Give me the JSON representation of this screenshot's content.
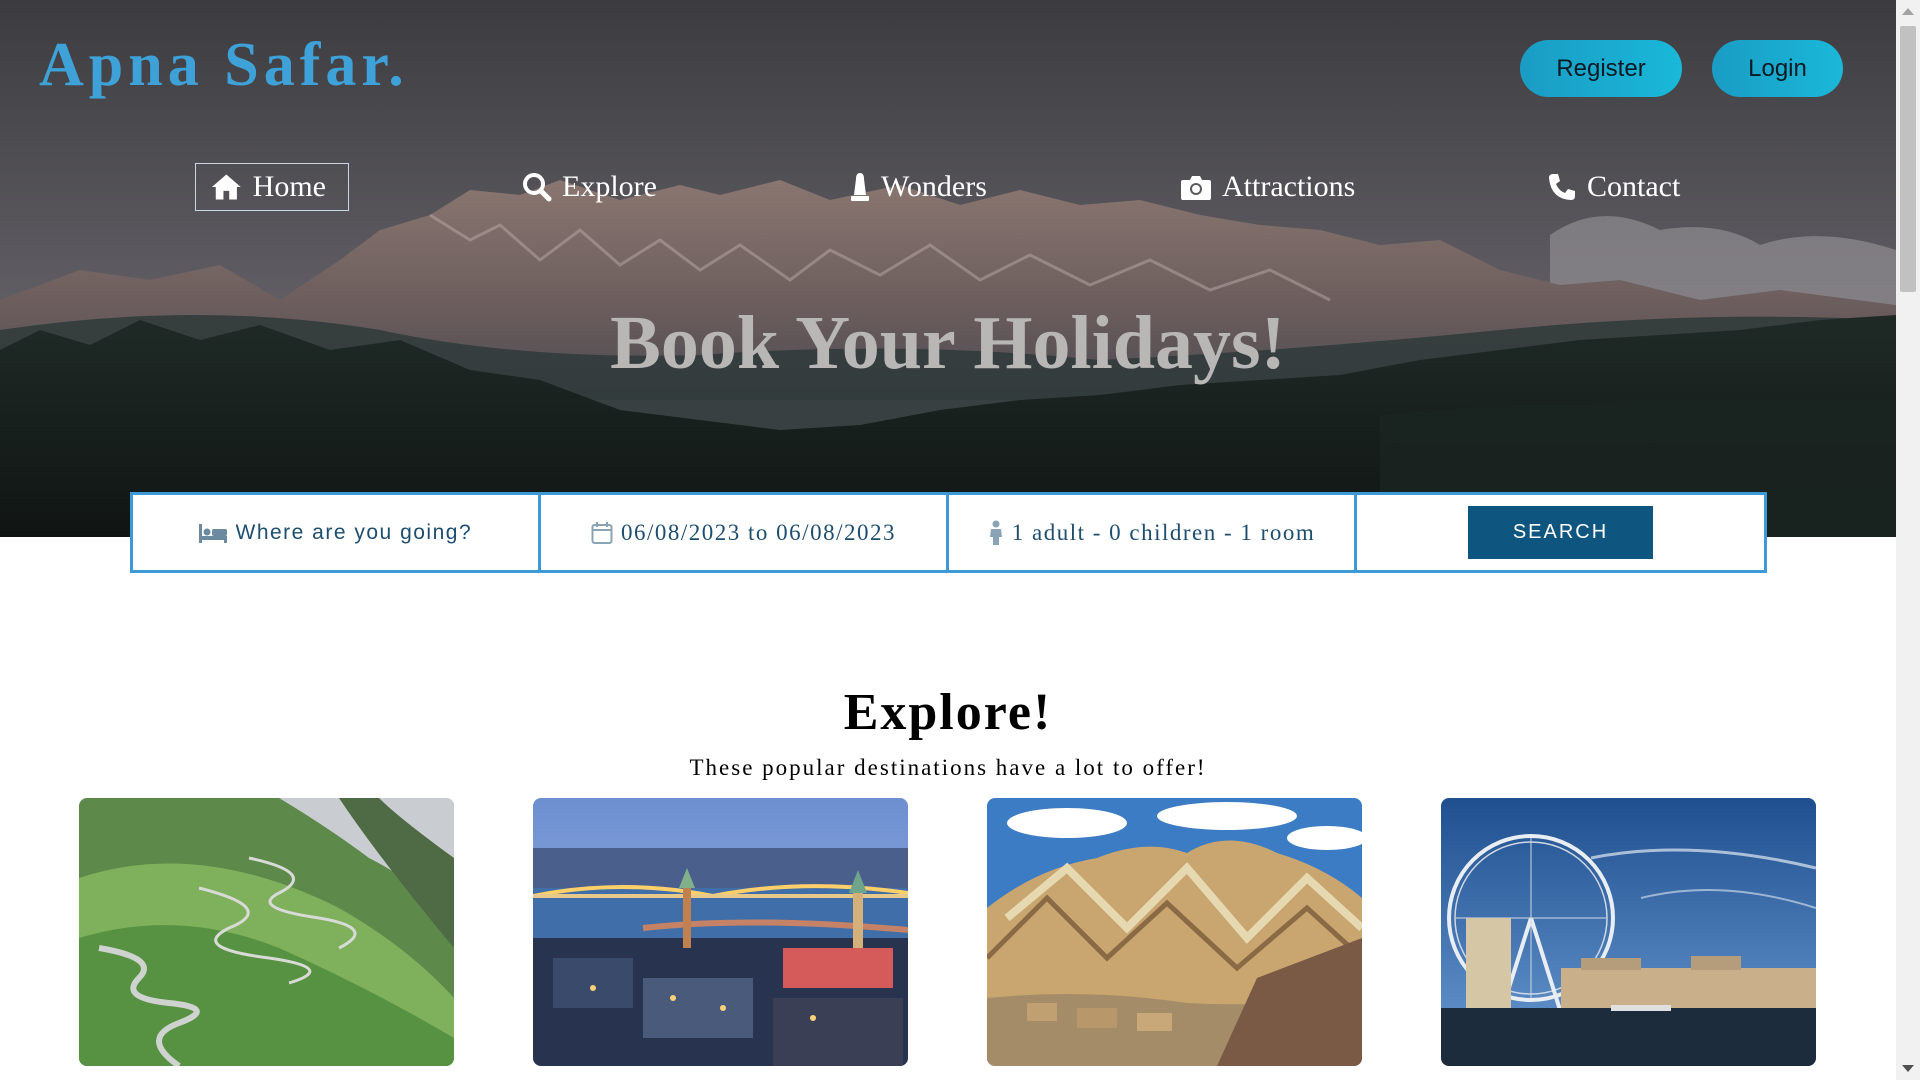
{
  "brand": {
    "name": "Apna Safar."
  },
  "auth": {
    "register_label": "Register",
    "login_label": "Login"
  },
  "nav": {
    "home": "Home",
    "explore": "Explore",
    "wonders": "Wonders",
    "attractions": "Attractions",
    "contact": "Contact"
  },
  "hero": {
    "title": "Book Your Holidays!"
  },
  "search": {
    "destination_placeholder": "Where are you going?",
    "dates": "06/08/2023 to 06/08/2023",
    "guests": "1 adult - 0 children - 1 room",
    "button_label": "SEARCH"
  },
  "explore": {
    "title": "Explore!",
    "subtitle": "These popular destinations have a lot to offer!"
  },
  "colors": {
    "brand": "#3ea2d9",
    "auth_button": "#1ab8d9",
    "search_border": "#3d9ad6",
    "search_button": "#0e5680",
    "search_text": "#1d4e70"
  },
  "icons": {
    "home": "home-icon",
    "explore": "search-icon",
    "wonders": "bell-icon",
    "attractions": "camera-icon",
    "contact": "phone-icon",
    "destination": "bed-icon",
    "dates": "calendar-icon",
    "guests": "person-icon"
  }
}
